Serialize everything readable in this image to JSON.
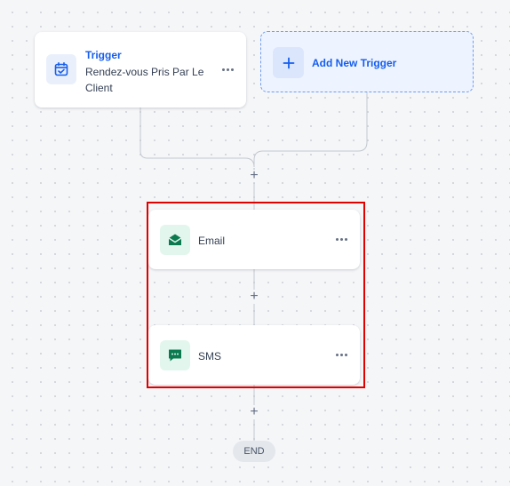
{
  "trigger": {
    "title": "Trigger",
    "subtitle": "Rendez-vous Pris Par Le Client",
    "icon": "calendar-check-icon"
  },
  "add_trigger": {
    "label": "Add New Trigger",
    "icon": "plus-icon"
  },
  "actions": [
    {
      "label": "Email",
      "icon": "envelope-open-icon"
    },
    {
      "label": "SMS",
      "icon": "chat-message-icon"
    }
  ],
  "end_label": "END",
  "colors": {
    "accent": "#155eef",
    "action_icon": "#0b7a4f",
    "highlight": "#e00000"
  }
}
